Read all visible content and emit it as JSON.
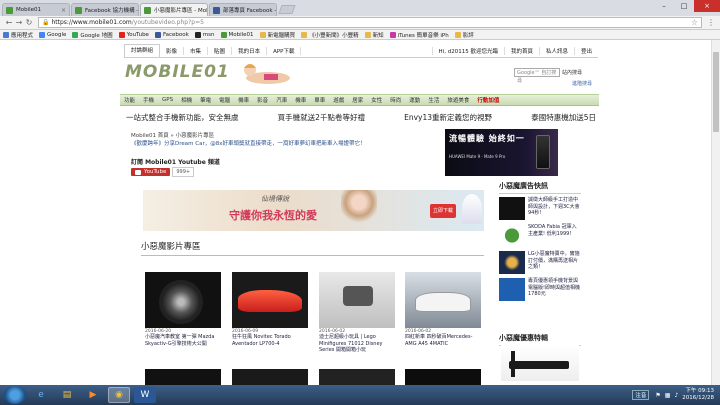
{
  "browser": {
    "tabs": [
      {
        "label": "Mobile01",
        "active": false
      },
      {
        "label": "Facebook 協力機構 - Mobi",
        "active": false
      },
      {
        "label": "小惡魔影片專區 - Mobi",
        "active": true
      },
      {
        "label": "部落專頁 Facebook - 部",
        "active": false
      }
    ],
    "url_host": "https://www.mobile01.com",
    "url_path": "/youtubevideo.php?p=5",
    "bookmarks": [
      "應用程式",
      "Google",
      "Google 地圖",
      "YouTube",
      "Facebook",
      "msn",
      "Mobile01",
      "新電腦購買",
      "《小豐新聞》小豐精",
      "新知",
      "iTunes 簡單音樂 iPh",
      "影評"
    ]
  },
  "site": {
    "top_tabs": [
      "討論群組",
      "影像",
      "市集",
      "貼圖",
      "我的日本",
      "APP下載"
    ],
    "user_links": [
      "Hi, d20115 歡迎您光臨",
      "我的首頁",
      "私人訊息",
      "登出"
    ],
    "logo": "MOBILE01",
    "search_button": "站內搜尋",
    "advanced_search": "進階搜尋",
    "categories": [
      "功能",
      "手機",
      "GPS",
      "相機",
      "筆電",
      "電腦",
      "機車",
      "影音",
      "汽車",
      "機車",
      "單車",
      "遊戲",
      "居家",
      "女性",
      "時尚",
      "運動",
      "生活",
      "旅遊美食",
      "行動加值"
    ],
    "promos": [
      "一站式整合手機新功能，安全無虞",
      "買手機就送2千點卷等好禮",
      "Envy13重新定義您的視野",
      "泰國特惠機加送5日"
    ],
    "breadcrumb": "Mobile01 首頁 » 小惡魔影片專區",
    "announcement": "《歡慶跨年》分享Dream Car，@8x好車頭獎就直接帶走，一窩好車夢幻車把新車入場證帶它！",
    "subscribe_label": "訂閱 Mobile01 Youtube 頻道",
    "youtube_button": "YouTube",
    "subscriber_count": "999+",
    "huawei_ad": {
      "headline": "流暢體驗 始終如一",
      "sub": "HUAWEI Mate 9 · Mate 9 Pro"
    },
    "banner_ad": {
      "title": "仙境傳說",
      "tagline": "守護你我永恆的愛",
      "cta": "立即下載"
    },
    "section_title": "小惡魔影片專區",
    "videos": [
      {
        "date": "2016-06-20",
        "title": "小惡魔汽車教室 第一彈 Mazda Skyactiv-G引擎技術大公開"
      },
      {
        "date": "2016-06-09",
        "title": "狂牛狂風 Novitec Torado Aventador LP700-4"
      },
      {
        "date": "2016-06-02",
        "title": "迪士尼超級小玩具 | Lego Minifigures 71012 Disney Series 開箱開箱小玩"
      },
      {
        "date": "2016-06-02",
        "title": "四紅新車 四秒破百Mercedes-AMG A45 4MATIC"
      }
    ],
    "sidebar_ads_title": "小惡魔廣告快訊",
    "sidebar_ads": [
      {
        "text": "誠徵大師級手工打造中師與設計，下週3C大會94秒!"
      },
      {
        "text": "SKODA Fabia 冠軍入主產業! 低利1999!"
      },
      {
        "text": "LG小惡魔特賣中，實施訂付價，滿購再送相片之類！"
      },
      {
        "text": "專頁優惠領手機背景與電腦版!即時與超值相機1780元"
      }
    ],
    "sidebar_second_title": "小惡魔優惠特輯"
  },
  "taskbar": {
    "ime": "注音",
    "time": "下午 09:13",
    "date": "2016/12/28"
  }
}
